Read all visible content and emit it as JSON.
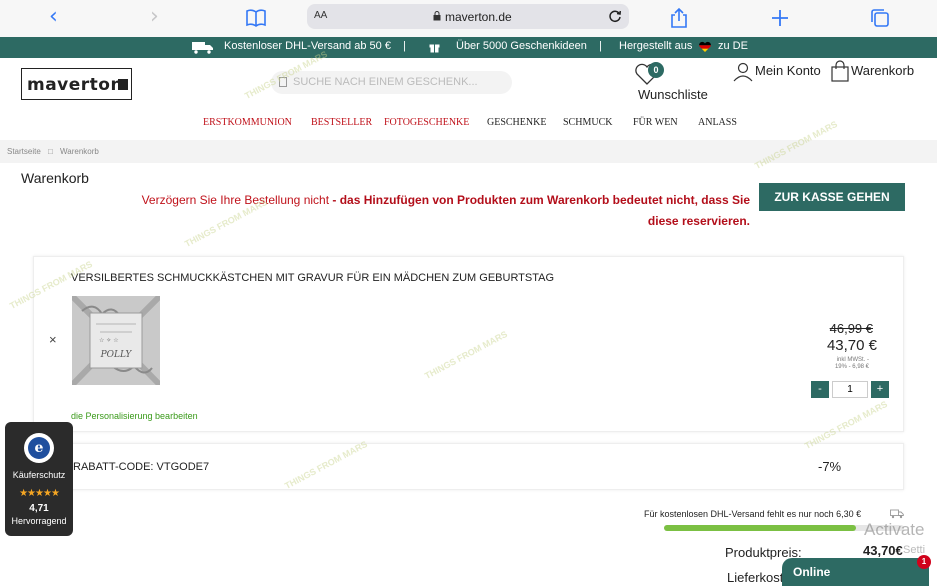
{
  "browser": {
    "text_size": "AA",
    "url": "maverton.de"
  },
  "promo": {
    "shipping": "Kostenloser DHL-Versand ab 50 €",
    "sep": "|",
    "gifts": "Über 5000 Geschenkideen",
    "made_in_prefix": "Hergestellt aus",
    "made_in_suffix": "zu DE"
  },
  "header": {
    "logo": "maverton",
    "search_placeholder": "SUCHE NACH EINEM GESCHENK...",
    "wishlist_count": "0",
    "wishlist_label": "Wunschliste",
    "account_label": "Mein Konto",
    "cart_label": "Warenkorb"
  },
  "nav": {
    "items": [
      "ERSTKOMMUNION",
      "BESTSELLER",
      "FOTOGESCHENKE",
      "GESCHENKE",
      "SCHMUCK",
      "FÜR WEN",
      "ANLASS"
    ]
  },
  "breadcrumb": {
    "home": "Startseite",
    "sep": "□",
    "current": "Warenkorb"
  },
  "cart": {
    "title": "Warenkorb",
    "urgency_light": "Verzögern Sie Ihre Bestellung nicht",
    "urgency_bold_1": "- das Hinzufügen von Produkten zum Warenkorb bedeutet nicht, dass Sie",
    "urgency_bold_2": "diese reservieren.",
    "checkout_label": "ZUR KASSE GEHEN",
    "item": {
      "title": "VERSILBERTES SCHMUCKKÄSTCHEN MIT GRAVUR FÜR EIN MÄDCHEN ZUM GEBURTSTAG",
      "remove": "×",
      "thumb_name": "POLLY",
      "edit_link": "die Personalisierung bearbeiten",
      "price_old": "46,99 €",
      "price_new": "43,70 €",
      "tax_line_1": "inkl MWSt. -",
      "tax_line_2": "19% - 6,98 €",
      "qty_minus": "-",
      "qty": "1",
      "qty_plus": "+"
    },
    "coupon": {
      "label": "RABATT-CODE: VTGODE7",
      "percent": "-7%"
    },
    "shipping_note": "Für kostenlosen DHL-Versand fehlt es nur noch 6,30 €",
    "shipping_progress": 0.8,
    "subtotal_label": "Produktpreis:",
    "subtotal_value": "43,70€",
    "delivery_label": "Lieferkost"
  },
  "trust": {
    "title": "Käuferschutz",
    "stars": "★★★★★",
    "score": "4,71",
    "rating": "Hervorragend"
  },
  "chat": {
    "label": "Online",
    "badge": "1"
  },
  "system": {
    "activate": "Activate",
    "settings": "Setti"
  },
  "colors": {
    "brand_green": "#2d6a63",
    "alert_red": "#c0121b",
    "link_green": "#3a9a1a",
    "progress_green": "#7bc043"
  }
}
